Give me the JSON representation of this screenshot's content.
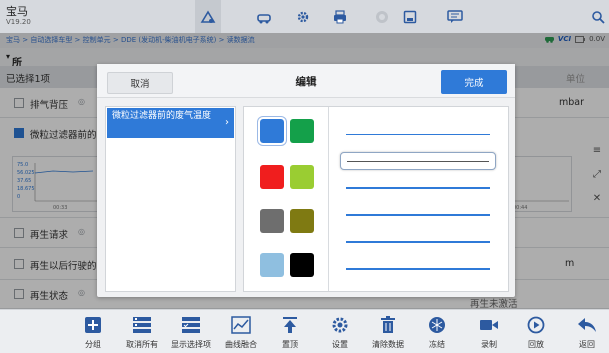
{
  "brand": {
    "title": "宝马",
    "version": "V19.20"
  },
  "breadcrumb": "宝马 > 自动选择车型 > 控制单元 > DDE (发动机-柴油机电子系统) > 读数据流",
  "status": {
    "vci_label": "VCI",
    "voltage": "0.0V"
  },
  "params": {
    "header": "所有参数",
    "selected_label": "已选择1项",
    "unit_col": "单位",
    "rows": [
      {
        "label": "排气背压",
        "checked": false,
        "unit": "mbar"
      },
      {
        "label": "微粒过滤器前的",
        "checked": true,
        "unit": ""
      },
      {
        "label": "再生请求",
        "checked": false,
        "unit": ""
      },
      {
        "label": "再生以后行驶的",
        "checked": false,
        "unit": "m"
      },
      {
        "label": "再生状态",
        "checked": false,
        "unit": ""
      }
    ],
    "graph_ticks": [
      "75.0",
      "56.025",
      "37.65",
      "18.675",
      "0"
    ],
    "graph_time_left": "00:33",
    "graph_time_right": "00:44",
    "status_value": "再生未激活"
  },
  "modal": {
    "title": "编辑",
    "cancel_label": "取消",
    "done_label": "完成",
    "param_item": "微粒过滤器前的废气温度",
    "colors": [
      "#2f7ad8",
      "#14a04a",
      "#f01e1e",
      "#9acd32",
      "#6e6e6e",
      "#7f7a12",
      "#8fbfe0",
      "#000000"
    ],
    "selected_color_index": 0,
    "line_styles": [
      "thin",
      "medium",
      "thick",
      "thicker",
      "thickest",
      "heaviest"
    ],
    "selected_line_index": 1
  },
  "toolbar": [
    {
      "id": "group",
      "label": "分组",
      "icon": "plus-square-icon"
    },
    {
      "id": "deselect-all",
      "label": "取消所有",
      "icon": "deselect-all-icon"
    },
    {
      "id": "show-selected",
      "label": "显示选择项",
      "icon": "show-selected-icon"
    },
    {
      "id": "merge-curves",
      "label": "曲线融合",
      "icon": "line-chart-icon"
    },
    {
      "id": "top",
      "label": "置顶",
      "icon": "pin-top-icon"
    },
    {
      "id": "settings",
      "label": "设置",
      "icon": "gear-icon"
    },
    {
      "id": "clear-data",
      "label": "清除数据",
      "icon": "trash-icon"
    },
    {
      "id": "freeze",
      "label": "冻结",
      "icon": "snowflake-icon"
    },
    {
      "id": "record",
      "label": "录制",
      "icon": "video-icon"
    },
    {
      "id": "playback",
      "label": "回放",
      "icon": "play-icon"
    },
    {
      "id": "back",
      "label": "返回",
      "icon": "back-arrow-icon"
    }
  ]
}
